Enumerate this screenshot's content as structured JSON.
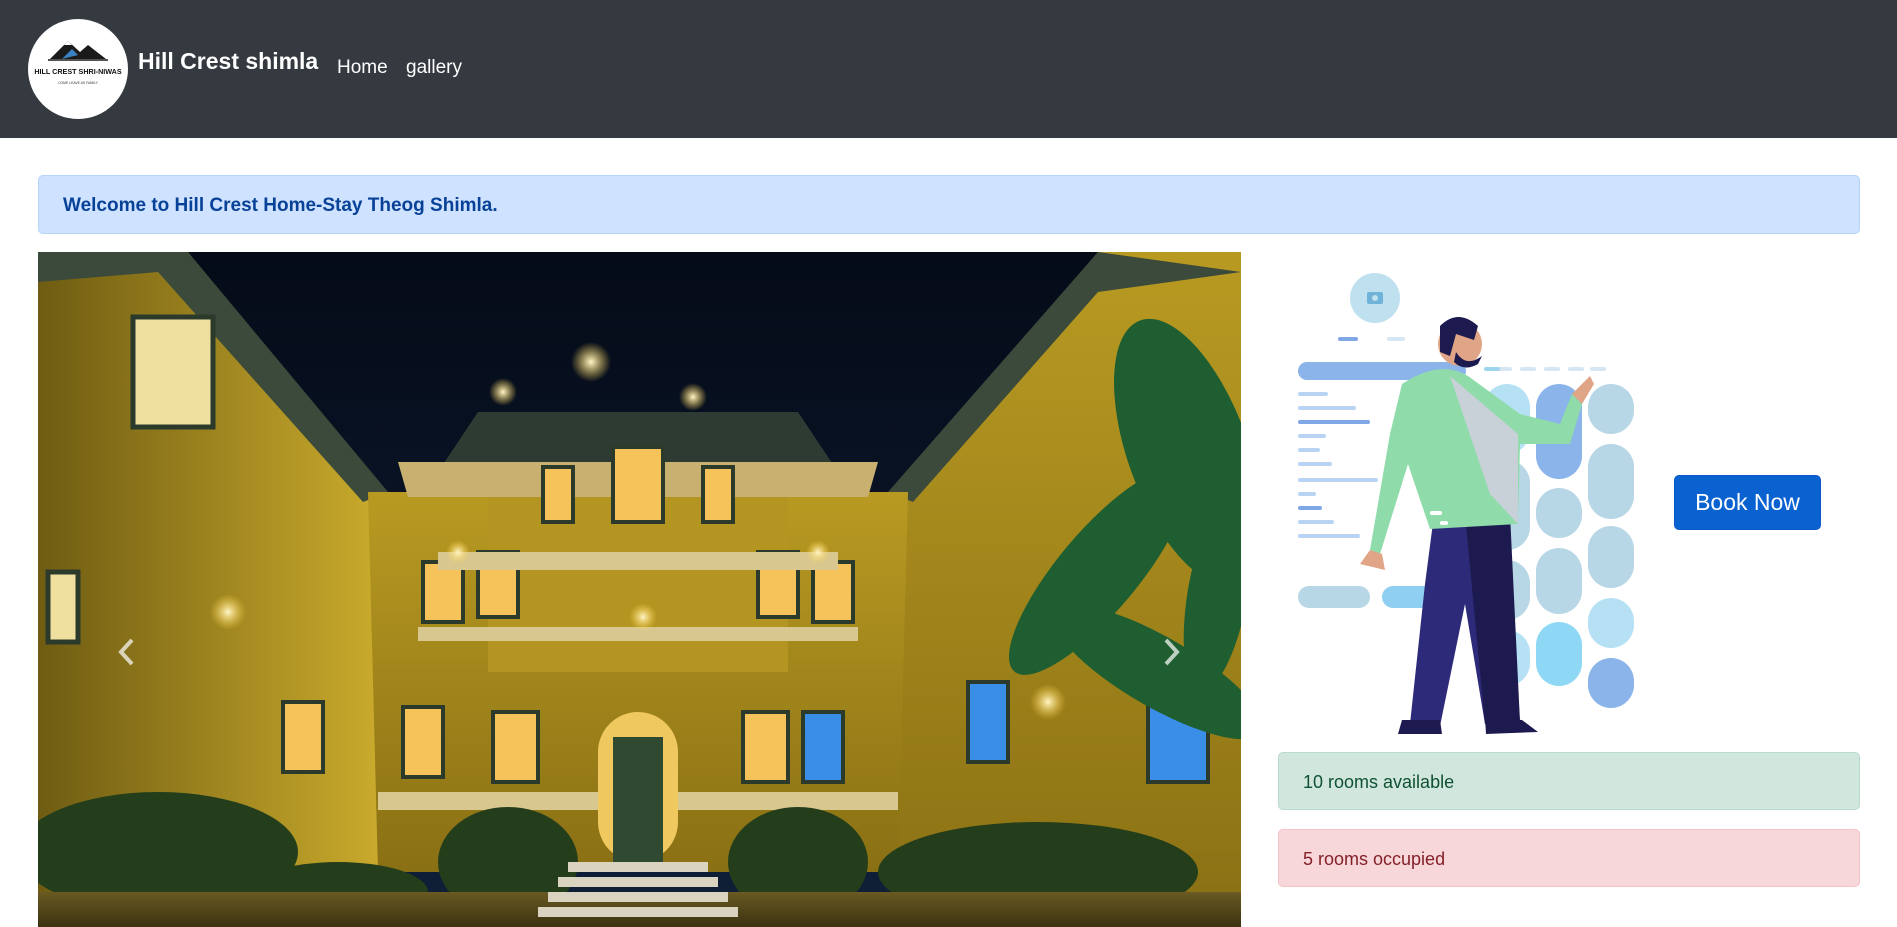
{
  "navbar": {
    "brand": "Hill Crest shimla",
    "logo_text": "HILL CREST SHRI-NIWAS",
    "logo_subtext": "COME LEAVE AS FAMILY",
    "links": [
      {
        "label": "Home"
      },
      {
        "label": "gallery"
      }
    ],
    "background": "#343a40"
  },
  "welcome": {
    "message": "Welcome to Hill Crest Home-Stay Theog Shimla."
  },
  "carousel": {
    "image": "illuminated-mansion-night-photo",
    "prev_icon": "chevron-left-icon",
    "next_icon": "chevron-right-icon"
  },
  "booking": {
    "illustration": "person-browsing-booking-ui-illustration",
    "button_label": "Book Now",
    "accent": "#0a62d0"
  },
  "status": {
    "available": "10 rooms available",
    "occupied": "5 rooms occupied"
  }
}
